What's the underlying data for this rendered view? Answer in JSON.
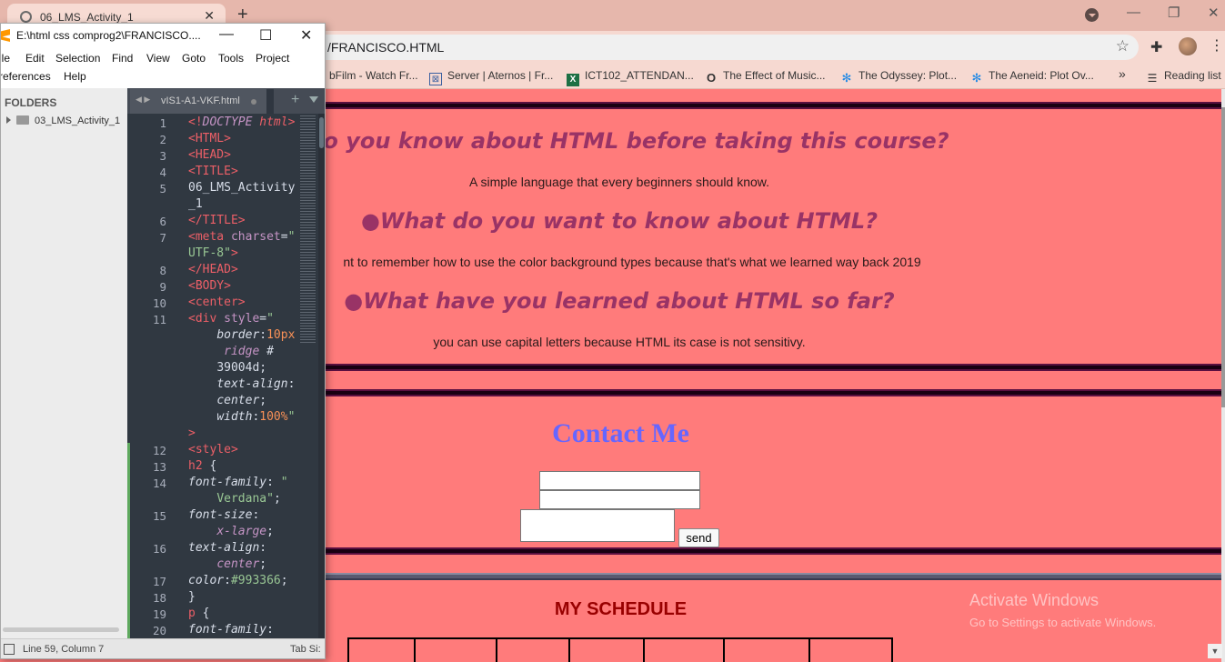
{
  "browser": {
    "tab_title": "06_LMS_Activity_1",
    "url": "/FRANCISCO.HTML",
    "new_tab_symbol": "+",
    "bookmarks": [
      {
        "label": "bFilm - Watch Fr...",
        "icon": "film-icon"
      },
      {
        "label": "Server | Aternos | Fr...",
        "icon": "aternos-icon"
      },
      {
        "label": "ICT102_ATTENDAN...",
        "icon": "excel-icon"
      },
      {
        "label": "The Effect of Music...",
        "icon": "o-icon"
      },
      {
        "label": "The Odyssey: Plot...",
        "icon": "snowflake-icon"
      },
      {
        "label": "The Aeneid: Plot Ov...",
        "icon": "snowflake-icon"
      }
    ],
    "bookmarks_more": "»",
    "reading_list": "Reading list"
  },
  "webpage": {
    "q1": "t do you know about HTML before taking this course?",
    "a1": "A simple language that every beginners should know.",
    "q2": "●What do you want to know about HTML?",
    "a2": "nt to remember how to use the color background types because that's what we learned way back 2019",
    "q3": "●What have you learned about HTML so far?",
    "a3": "you can use capital letters because HTML its case is not sensitivy.",
    "contact_title": "Contact Me",
    "send_label": "send",
    "schedule_title": "MY SCHEDULE",
    "activate_line1": "Activate Windows",
    "activate_line2": "Go to Settings to activate Windows."
  },
  "sublime": {
    "title": "E:\\html css comprog2\\FRANCISCO....",
    "menu": [
      "ile",
      "Edit",
      "Selection",
      "Find",
      "View",
      "Goto",
      "Tools",
      "Project",
      "references",
      "Help"
    ],
    "sidebar_heading": "FOLDERS",
    "folder": "03_LMS_Activity_1",
    "tab_name": "vIS1-A1-VKF.html",
    "status_position": "Line 59, Column 7",
    "status_tab": "Tab Si:",
    "line_numbers": [
      "1",
      "2",
      "3",
      "4",
      "5",
      "6",
      "7",
      "8",
      "9",
      "10",
      "11",
      "12",
      "13",
      "14",
      "15",
      "16",
      "17",
      "18",
      "19",
      "20"
    ]
  },
  "colors": {
    "page_background": "#ff7b7b",
    "heading_color": "#993366",
    "contact_color": "#6666ff",
    "schedule_color": "#990000",
    "editor_background": "#303841"
  }
}
